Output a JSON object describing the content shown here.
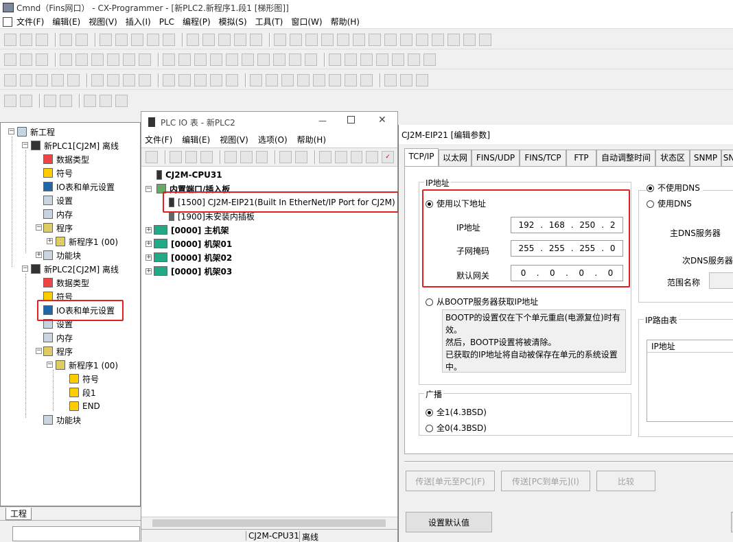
{
  "app": {
    "title": "Cmnd（Fins网口） - CX-Programmer - [新PLC2.新程序1.段1 [梯形图]]",
    "menu": [
      "文件(F)",
      "编辑(E)",
      "视图(V)",
      "插入(I)",
      "PLC",
      "编程(P)",
      "模拟(S)",
      "工具(T)",
      "窗口(W)",
      "帮助(H)"
    ]
  },
  "tree": {
    "root": "新工程",
    "plc1": {
      "label": "新PLC1[CJ2M] 离线",
      "items": [
        "数据类型",
        "符号",
        "IO表和单元设置",
        "设置",
        "内存",
        "程序",
        "新程序1 (00)",
        "功能块"
      ]
    },
    "plc2": {
      "label": "新PLC2[CJ2M] 离线",
      "items": [
        "数据类型",
        "符号",
        "IO表和单元设置",
        "设置",
        "内存",
        "程序",
        "新程序1 (00)",
        "符号",
        "段1",
        "END",
        "功能块"
      ]
    },
    "tab_label": "工程"
  },
  "io_window": {
    "title": "PLC IO 表 - 新PLC2",
    "menu": [
      "文件(F)",
      "编辑(E)",
      "视图(V)",
      "选项(O)",
      "帮助(H)"
    ],
    "rows": [
      "CJ2M-CPU31",
      "内置端口/插入板",
      "[1500] CJ2M-EIP21(Built In EtherNet/IP Port for CJ2M)",
      "[1900]未安装内插板",
      "[0000] 主机架",
      "[0000] 机架01",
      "[0000] 机架02",
      "[0000] 机架03"
    ],
    "status": [
      "CJ2M-CPU31",
      "离线"
    ]
  },
  "dialog": {
    "title": "CJ2M-EIP21 [编辑参数]",
    "tabs": [
      "TCP/IP",
      "以太网",
      "FINS/UDP",
      "FINS/TCP",
      "FTP",
      "自动调整时间",
      "状态区",
      "SNMP",
      "SN"
    ],
    "ip_group": "IP地址",
    "use_following": "使用以下地址",
    "ip_label": "IP地址",
    "ip": [
      "192",
      "168",
      "250",
      "2"
    ],
    "mask_label": "子网掩码",
    "mask": [
      "255",
      "255",
      "255",
      "0"
    ],
    "gw_label": "默认网关",
    "gw": [
      "0",
      "0",
      "0",
      "0"
    ],
    "bootp": "从BOOTP服务器获取IP地址",
    "bootp_note": [
      "BOOTP的设置仅在下个单元重启(电源复位)时有",
      "效。",
      "然后，BOOTP设置将被清除。",
      "已获取的IP地址将自动被保存在单元的系统设置",
      "中。"
    ],
    "broadcast_group": "广播",
    "bc1": "全1(4.3BSD)",
    "bc0": "全0(4.3BSD)",
    "no_dns": "不使用DNS",
    "use_dns": "使用DNS",
    "primary_dns": "主DNS服务器",
    "secondary_dns": "次DNS服务器",
    "domain_name": "范围名称",
    "ip_route": "IP路由表",
    "ip_route_col": "IP地址",
    "btn_transfer_up": "传送[单元至PC](F)",
    "btn_transfer_down": "传送[PC到单元](I)",
    "btn_compare": "比较",
    "btn_default": "设置默认值"
  }
}
